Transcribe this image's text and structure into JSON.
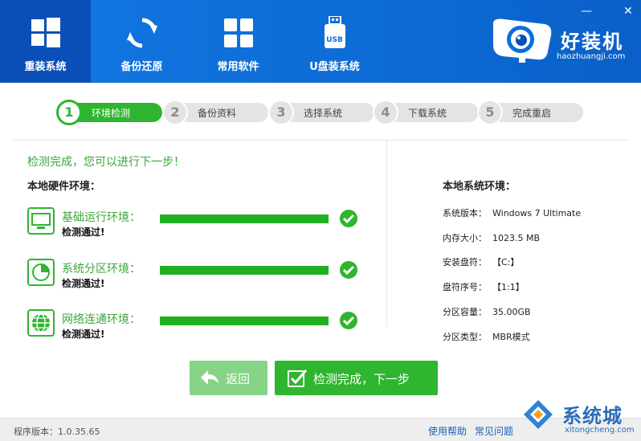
{
  "nav": [
    {
      "label": "重装系统",
      "icon": "windows-icon",
      "active": true
    },
    {
      "label": "备份还原",
      "icon": "sync-icon",
      "active": false
    },
    {
      "label": "常用软件",
      "icon": "apps-grid-icon",
      "active": false
    },
    {
      "label": "U盘装系统",
      "icon": "usb-icon",
      "active": false
    }
  ],
  "usb_text": "USB",
  "window_controls": {
    "minimize": "—",
    "close": "✕"
  },
  "brand": {
    "name": "好装机",
    "domain": "haozhuangji.com"
  },
  "steps": [
    {
      "num": "1",
      "label": "环境检测",
      "active": true
    },
    {
      "num": "2",
      "label": "备份资料",
      "active": false
    },
    {
      "num": "3",
      "label": "选择系统",
      "active": false
    },
    {
      "num": "4",
      "label": "下载系统",
      "active": false
    },
    {
      "num": "5",
      "label": "完成重启",
      "active": false
    }
  ],
  "status_message": "检测完成，您可以进行下一步！",
  "hardware": {
    "title": "本地硬件环境：",
    "checks": [
      {
        "name": "基础运行环境：",
        "result": "检测通过!",
        "icon": "monitor-icon",
        "progress": 1.0
      },
      {
        "name": "系统分区环境：",
        "result": "检测通过!",
        "icon": "pie-chart-icon",
        "progress": 1.0
      },
      {
        "name": "网络连通环境：",
        "result": "检测通过!",
        "icon": "globe-icon",
        "progress": 1.0
      }
    ]
  },
  "system": {
    "title": "本地系统环境：",
    "rows": [
      {
        "key": "系统版本：",
        "value": "Windows 7 Ultimate"
      },
      {
        "key": "内存大小：",
        "value": "1023.5 MB"
      },
      {
        "key": "安装盘符：",
        "value": "【C:】"
      },
      {
        "key": "盘符序号：",
        "value": "【1:1】"
      },
      {
        "key": "分区容量：",
        "value": "35.00GB"
      },
      {
        "key": "分区类型：",
        "value": "MBR模式"
      }
    ]
  },
  "buttons": {
    "back": "返回",
    "next": "检测完成，下一步"
  },
  "footer": {
    "version": "程序版本：1.0.35.65",
    "help": "使用帮助",
    "faq": "常见问题"
  },
  "watermark": {
    "text": "系统城",
    "sub": "xitongcheng.com"
  },
  "colors": {
    "primary": "#0a6fdc",
    "accent_green": "#2fb52f"
  }
}
